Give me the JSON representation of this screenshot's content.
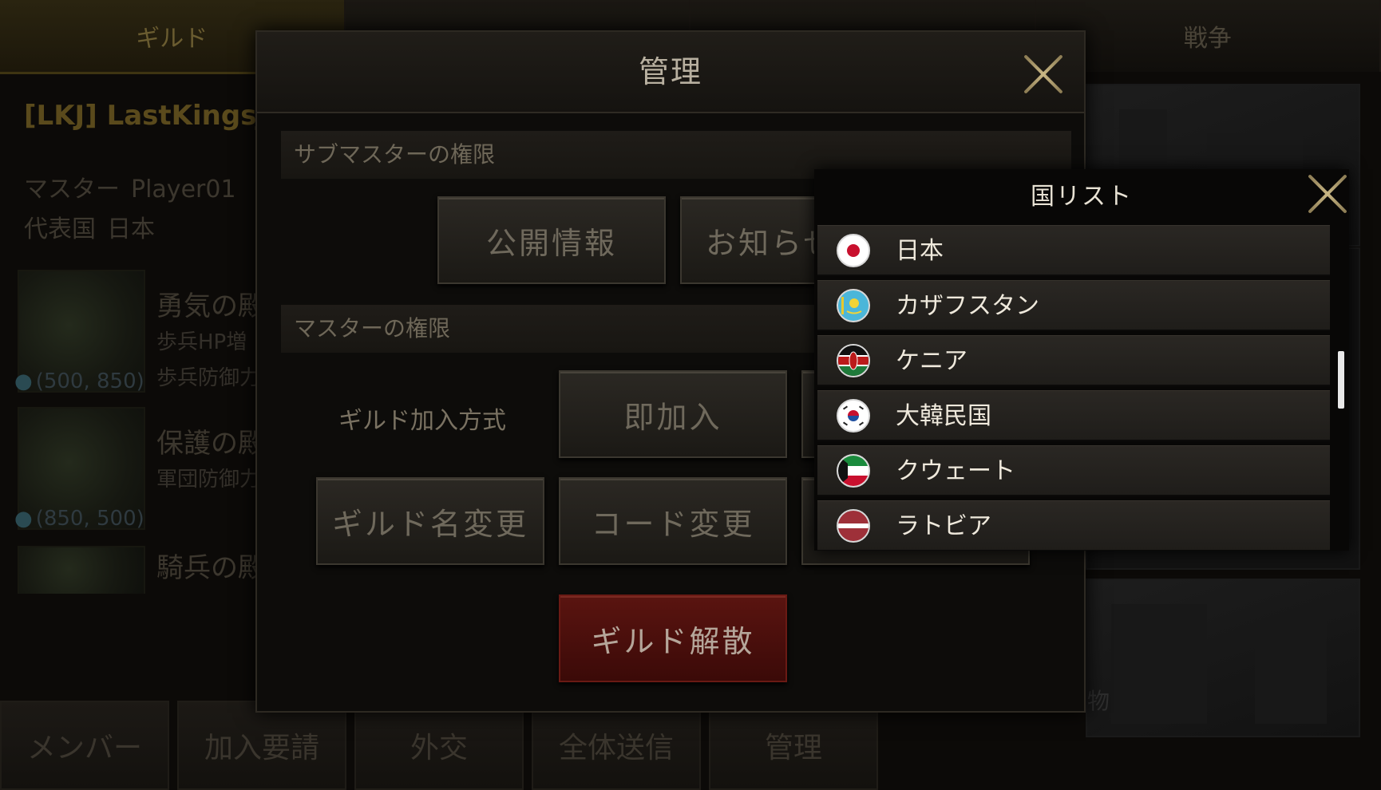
{
  "background": {
    "top_tabs": [
      {
        "label": "ギルド",
        "active": true
      },
      {
        "label": "",
        "active": false
      },
      {
        "label": "",
        "active": false
      },
      {
        "label": "戦争",
        "active": false
      }
    ],
    "guild_name": "[LKJ] LastKingsJP",
    "master_label": "マスター",
    "master_value": "Player01",
    "country_label": "代表国",
    "country_value": "日本",
    "bonuses": [
      {
        "title": "勇気の殿",
        "desc": [
          "歩兵HP増",
          "歩兵防御力"
        ],
        "coord": "(500, 850)"
      },
      {
        "title": "保護の殿",
        "desc": [
          "軍団防御力"
        ],
        "coord": "(850, 500)"
      },
      {
        "title": "騎兵の殿",
        "desc": [],
        "coord": ""
      }
    ],
    "bottom_tabs": [
      "メンバー",
      "加入要請",
      "外交",
      "全体送信",
      "管理"
    ],
    "scene_text": "物"
  },
  "modal": {
    "title": "管理",
    "sub_master_section": "サブマスターの権限",
    "public_info_button": "公開情報",
    "notice_button": "お知らせ",
    "master_section": "マスターの権限",
    "join_method_label": "ギルド加入方式",
    "instant_join_button": "即加入",
    "rename_button": "ギルド名変更",
    "code_change_button": "コード変更",
    "disband_button": "ギルド解散"
  },
  "country_list": {
    "title": "国リスト",
    "items": [
      {
        "name": "日本",
        "flag": "japan-flag-icon"
      },
      {
        "name": "カザフスタン",
        "flag": "kazakhstan-flag-icon"
      },
      {
        "name": "ケニア",
        "flag": "kenya-flag-icon"
      },
      {
        "name": "大韓民国",
        "flag": "south-korea-flag-icon"
      },
      {
        "name": "クウェート",
        "flag": "kuwait-flag-icon"
      },
      {
        "name": "ラトビア",
        "flag": "latvia-flag-icon"
      }
    ]
  },
  "colors": {
    "accent_gold": "#c8b684",
    "disband_red": "#5a1410"
  }
}
